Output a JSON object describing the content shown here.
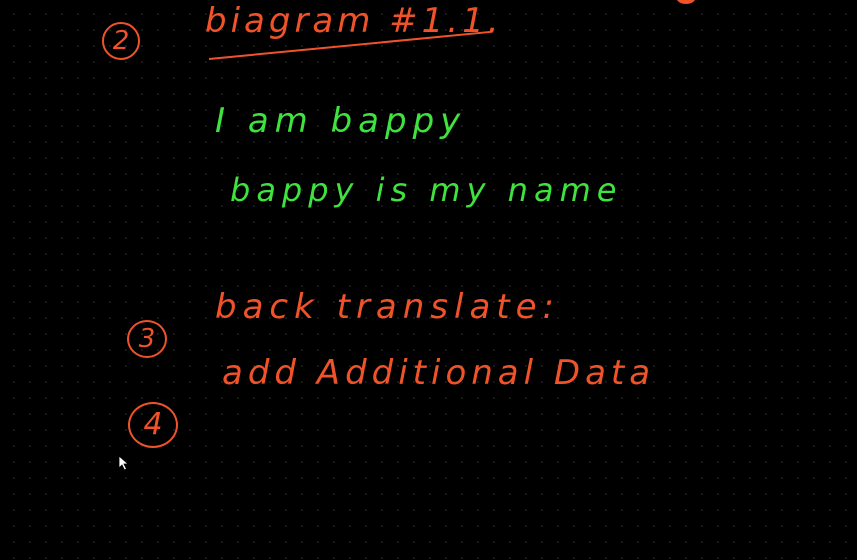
{
  "colors": {
    "background": "#000000",
    "ink_orange": "#f0532a",
    "ink_green": "#3fe23f",
    "grid_dot": "#1e1e1e"
  },
  "items": [
    {
      "number": "2",
      "text": "biagram #1.1."
    },
    {
      "number": "3",
      "text": "back translate:"
    },
    {
      "number": "4",
      "text": "add  Additional  Data"
    }
  ],
  "green_lines": [
    "I  am  bappy",
    "bappy  is  my  name"
  ],
  "cursor_icon": "arrow-pointer"
}
